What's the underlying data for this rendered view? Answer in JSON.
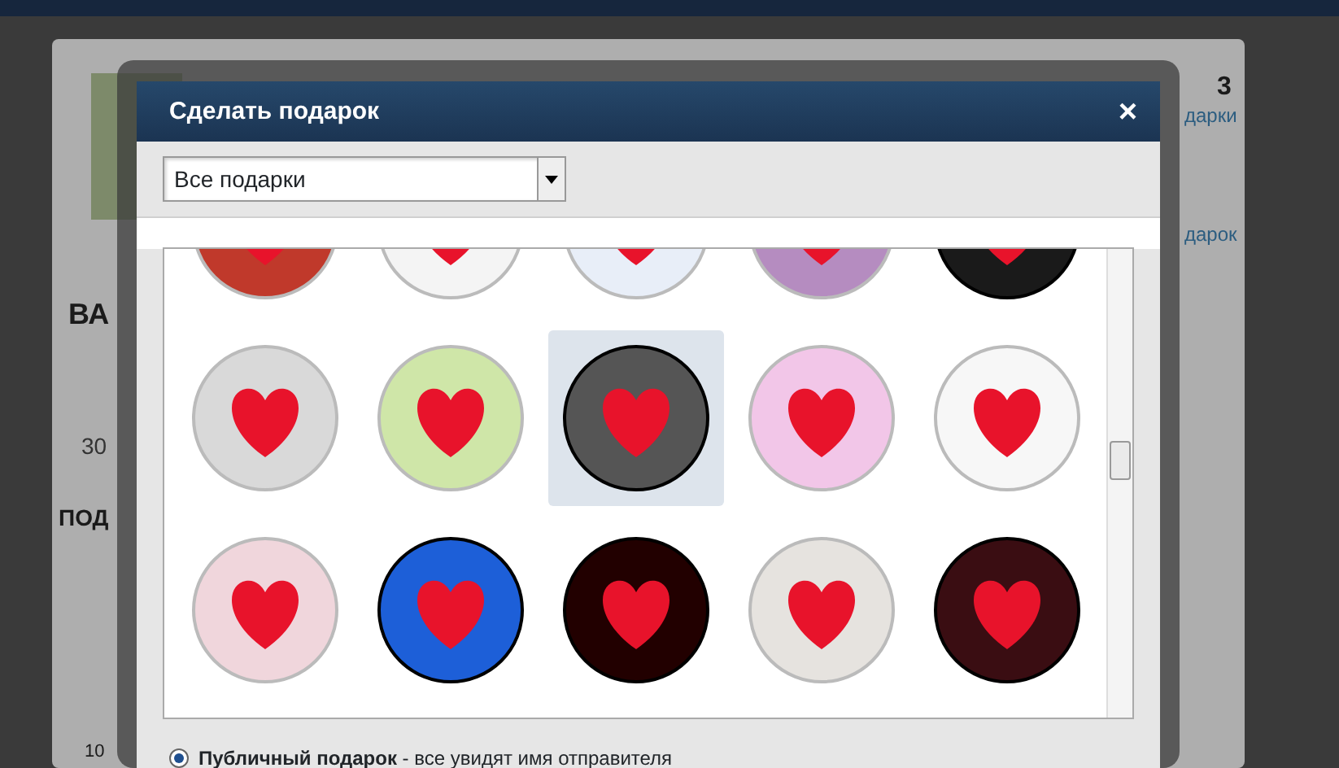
{
  "background": {
    "badge_count": "3",
    "badge_link": "дарки",
    "second_link": "дарок",
    "section_heading": "ВА",
    "field_value": "30",
    "second_heading": "ПОД",
    "small_number": "10"
  },
  "modal": {
    "title": "Сделать подарок",
    "close": "×",
    "filter": {
      "value": "Все подарки"
    },
    "gifts": [
      {
        "color": "#c0392b",
        "selected": false
      },
      {
        "color": "#f4f4f4",
        "selected": false
      },
      {
        "color": "#e8eef8",
        "selected": false
      },
      {
        "color": "#b58cc0",
        "selected": false
      },
      {
        "color": "#1a1a1a",
        "selected": false
      },
      {
        "color": "#d9d9d9",
        "selected": false
      },
      {
        "color": "#cfe6a8",
        "selected": false
      },
      {
        "color": "#555555",
        "selected": true
      },
      {
        "color": "#f2c6e8",
        "selected": false
      },
      {
        "color": "#f7f7f7",
        "selected": false
      },
      {
        "color": "#f0d6dc",
        "selected": false
      },
      {
        "color": "#1d5fd8",
        "selected": false
      },
      {
        "color": "#220000",
        "selected": false
      },
      {
        "color": "#e6e3df",
        "selected": false
      },
      {
        "color": "#3a0d12",
        "selected": false
      }
    ],
    "options": [
      {
        "label": "**Публичный подарок** - все увидят имя отправителя",
        "selected": true
      }
    ]
  }
}
